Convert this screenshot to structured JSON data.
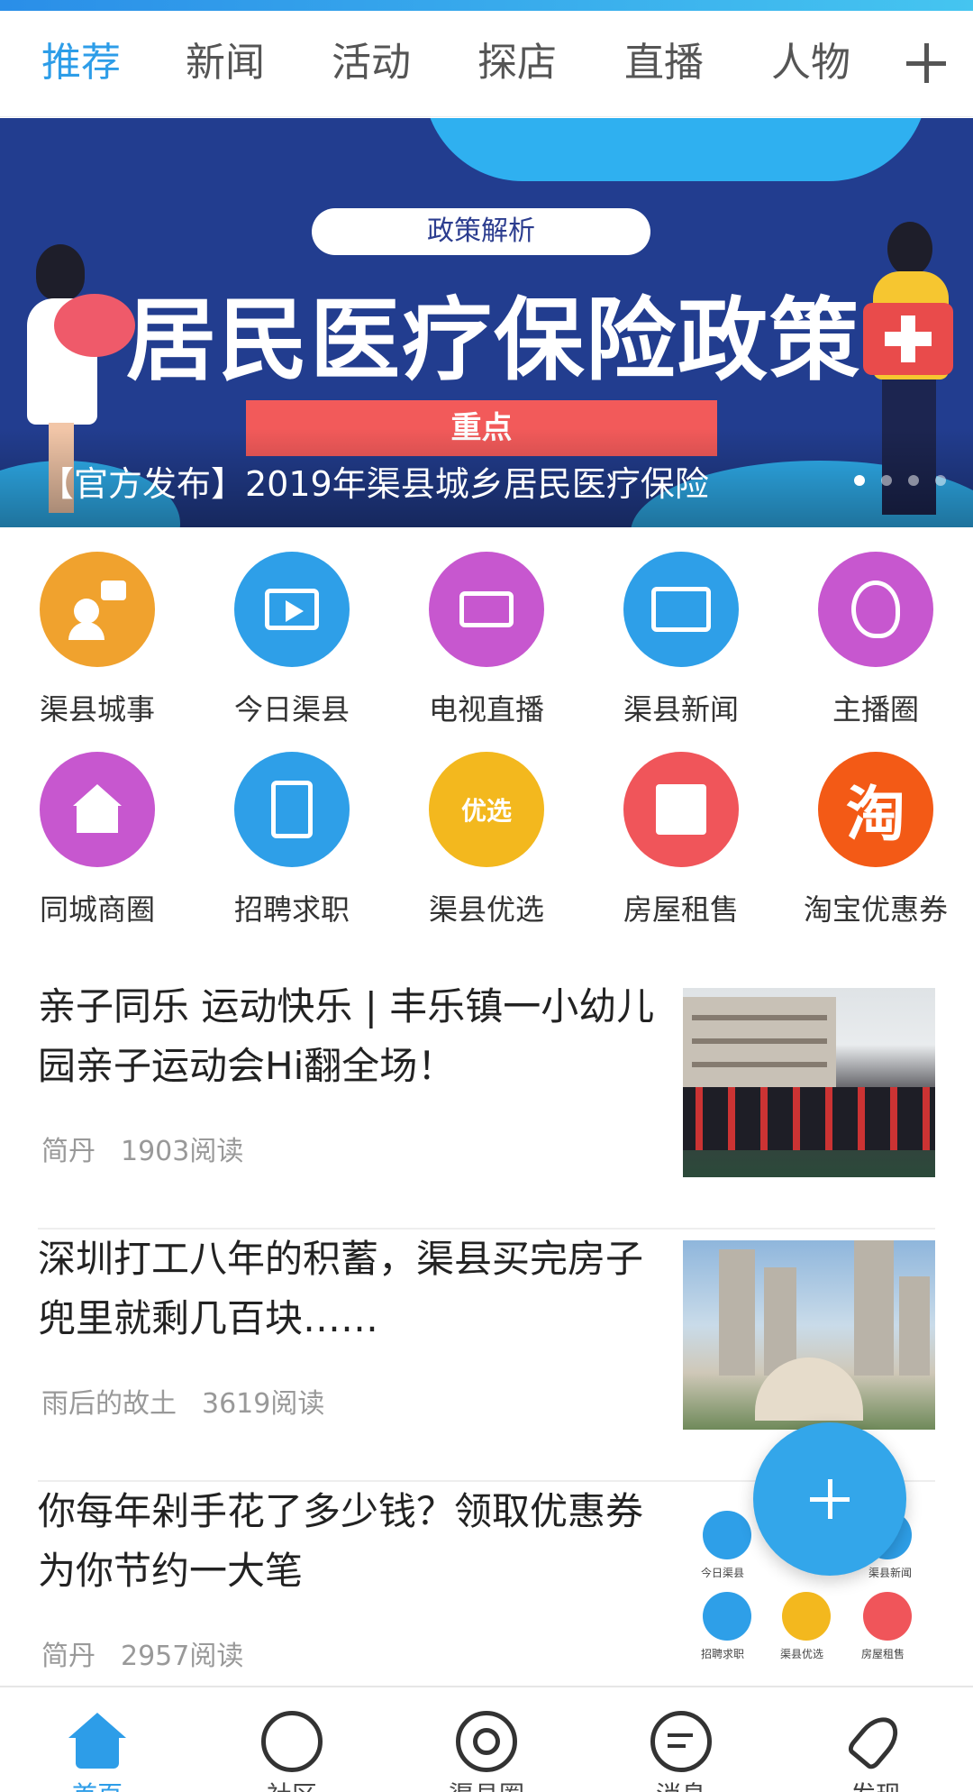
{
  "tabs": {
    "items": [
      "推荐",
      "新闻",
      "活动",
      "探店",
      "直播",
      "人物"
    ],
    "active": "推荐"
  },
  "banner": {
    "pill": "政策解析",
    "headline": "居民医疗保险政策",
    "tag": "重点",
    "caption": "【官方发布】2019年渠县城乡居民医疗保险",
    "page_count": 4,
    "active_page": 1
  },
  "grid": {
    "items": [
      {
        "label": "渠县城事",
        "icon": "person-speech-icon",
        "color": "#f0a22e"
      },
      {
        "label": "今日渠县",
        "icon": "film-play-icon",
        "color": "#2e9fe8"
      },
      {
        "label": "电视直播",
        "icon": "clapperboard-icon",
        "color": "#c757cf"
      },
      {
        "label": "渠县新闻",
        "icon": "tv-news-icon",
        "color": "#2e9fe8"
      },
      {
        "label": "主播圈",
        "icon": "profile-swirl-icon",
        "color": "#c757cf"
      },
      {
        "label": "同城商圈",
        "icon": "house-handshake-icon",
        "color": "#c757cf"
      },
      {
        "label": "招聘求职",
        "icon": "clipboard-list-icon",
        "color": "#2e9fe8"
      },
      {
        "label": "渠县优选",
        "icon": "cloud-logo-icon",
        "color": "#f3b81e",
        "icon_text": "优选"
      },
      {
        "label": "房屋租售",
        "icon": "building-icon",
        "color": "#f0555a"
      },
      {
        "label": "淘宝优惠券",
        "icon": "taobao-icon",
        "color": "#f35a16",
        "icon_text": "淘"
      }
    ]
  },
  "articles": [
    {
      "title": "亲子同乐 运动快乐 | 丰乐镇一小幼儿园亲子运动会Hi翻全场！",
      "author": "简丹",
      "reads": "1903阅读"
    },
    {
      "title": "深圳打工八年的积蓄，渠县买完房子兜里就剩几百块……",
      "author": "雨后的故土",
      "reads": "3619阅读"
    },
    {
      "title": "你每年剁手花了多少钱？领取优惠券为你节约一大笔",
      "author": "简丹",
      "reads": "2957阅读"
    }
  ],
  "thumb_app": {
    "labels": [
      "今日渠县",
      "渠县新闻",
      "招聘求职",
      "渠县优选",
      "房屋租售"
    ]
  },
  "bottom_nav": {
    "items": [
      {
        "label": "首页",
        "icon": "home-icon"
      },
      {
        "label": "社区",
        "icon": "community-icon"
      },
      {
        "label": "渠县圈",
        "icon": "planet-icon"
      },
      {
        "label": "消息",
        "icon": "chat-bubble-icon"
      },
      {
        "label": "发现",
        "icon": "rocket-icon"
      }
    ],
    "active": "首页"
  },
  "colors": {
    "accent": "#2d9de8",
    "banner_bg": "#223d8f",
    "fab": "#33a6ea"
  }
}
